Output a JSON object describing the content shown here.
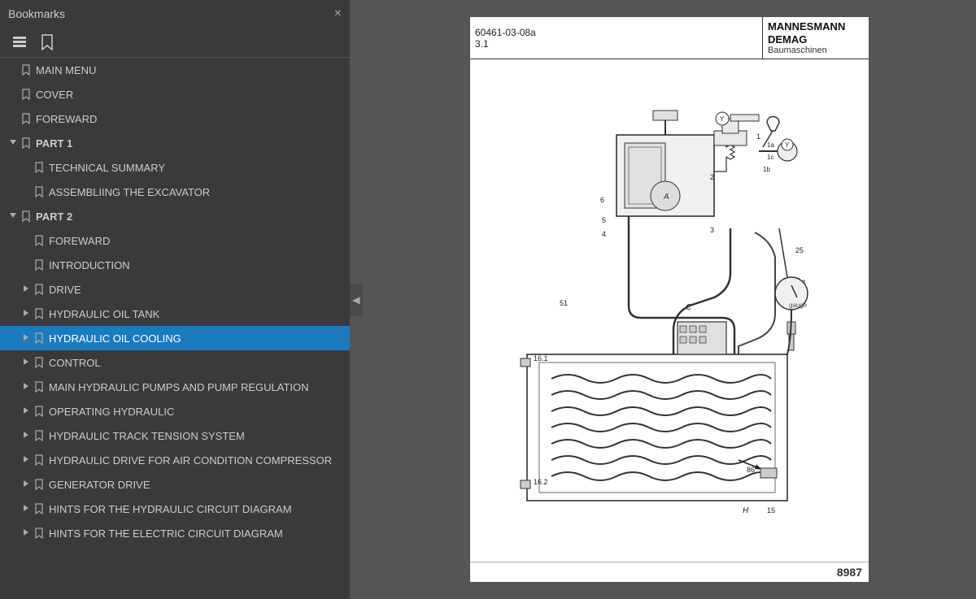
{
  "leftPanel": {
    "title": "Bookmarks",
    "closeLabel": "×",
    "toolbar": {
      "listViewLabel": "☰",
      "bookmarkViewLabel": "🔖"
    },
    "items": [
      {
        "id": "main-menu",
        "label": "MAIN MENU",
        "indent": 0,
        "hasArrow": false,
        "expandState": null,
        "active": false
      },
      {
        "id": "cover",
        "label": "COVER",
        "indent": 0,
        "hasArrow": false,
        "expandState": null,
        "active": false
      },
      {
        "id": "foreward-1",
        "label": "FOREWARD",
        "indent": 0,
        "hasArrow": false,
        "expandState": null,
        "active": false
      },
      {
        "id": "part-1",
        "label": "PART 1",
        "indent": 0,
        "hasArrow": false,
        "expandState": "open",
        "active": false,
        "isPart": true
      },
      {
        "id": "technical-summary",
        "label": "TECHNICAL SUMMARY",
        "indent": 1,
        "hasArrow": false,
        "expandState": null,
        "active": false
      },
      {
        "id": "assembling",
        "label": "ASSEMBLIING THE EXCAVATOR",
        "indent": 1,
        "hasArrow": false,
        "expandState": null,
        "active": false
      },
      {
        "id": "part-2",
        "label": "PART 2",
        "indent": 0,
        "hasArrow": false,
        "expandState": "open",
        "active": false,
        "isPart": true
      },
      {
        "id": "foreward-2",
        "label": "FOREWARD",
        "indent": 1,
        "hasArrow": false,
        "expandState": null,
        "active": false
      },
      {
        "id": "introduction",
        "label": "INTRODUCTION",
        "indent": 1,
        "hasArrow": false,
        "expandState": null,
        "active": false
      },
      {
        "id": "drive",
        "label": "DRIVE",
        "indent": 1,
        "hasArrow": true,
        "expandState": "collapsed",
        "active": false
      },
      {
        "id": "hydraulic-oil-tank",
        "label": "HYDRAULIC OIL TANK",
        "indent": 1,
        "hasArrow": true,
        "expandState": "collapsed",
        "active": false
      },
      {
        "id": "hydraulic-oil-cooling",
        "label": "HYDRAULIC OIL COOLING",
        "indent": 1,
        "hasArrow": true,
        "expandState": "collapsed",
        "active": true
      },
      {
        "id": "control",
        "label": "CONTROL",
        "indent": 1,
        "hasArrow": true,
        "expandState": "collapsed",
        "active": false
      },
      {
        "id": "main-hydraulic-pumps",
        "label": "MAIN HYDRAULIC PUMPS AND PUMP REGULATION",
        "indent": 1,
        "hasArrow": true,
        "expandState": "collapsed",
        "active": false
      },
      {
        "id": "operating-hydraulic",
        "label": "OPERATING HYDRAULIC",
        "indent": 1,
        "hasArrow": true,
        "expandState": "collapsed",
        "active": false
      },
      {
        "id": "hydraulic-track",
        "label": "HYDRAULIC TRACK TENSION SYSTEM",
        "indent": 1,
        "hasArrow": true,
        "expandState": "collapsed",
        "active": false
      },
      {
        "id": "hydraulic-drive-ac",
        "label": "HYDRAULIC DRIVE FOR AIR CONDITION COMPRESSOR",
        "indent": 1,
        "hasArrow": true,
        "expandState": "collapsed",
        "active": false
      },
      {
        "id": "generator-drive",
        "label": "GENERATOR DRIVE",
        "indent": 1,
        "hasArrow": true,
        "expandState": "collapsed",
        "active": false
      },
      {
        "id": "hints-hydraulic",
        "label": "HINTS FOR THE HYDRAULIC CIRCUIT DIAGRAM",
        "indent": 1,
        "hasArrow": true,
        "expandState": "collapsed",
        "active": false
      },
      {
        "id": "hints-electric",
        "label": "HINTS FOR THE ELECTRIC CIRCUIT DIAGRAM",
        "indent": 1,
        "hasArrow": true,
        "expandState": "collapsed",
        "active": false
      }
    ]
  },
  "rightPanel": {
    "collapseLabel": "◀",
    "document": {
      "refNumber": "60461-03-08a",
      "pageNumber": "3.1",
      "logoLine1": "MANNESMANN",
      "logoLine2": "DEMAG",
      "logoLine3": "Baumaschinen",
      "footerNumber": "8987"
    }
  }
}
